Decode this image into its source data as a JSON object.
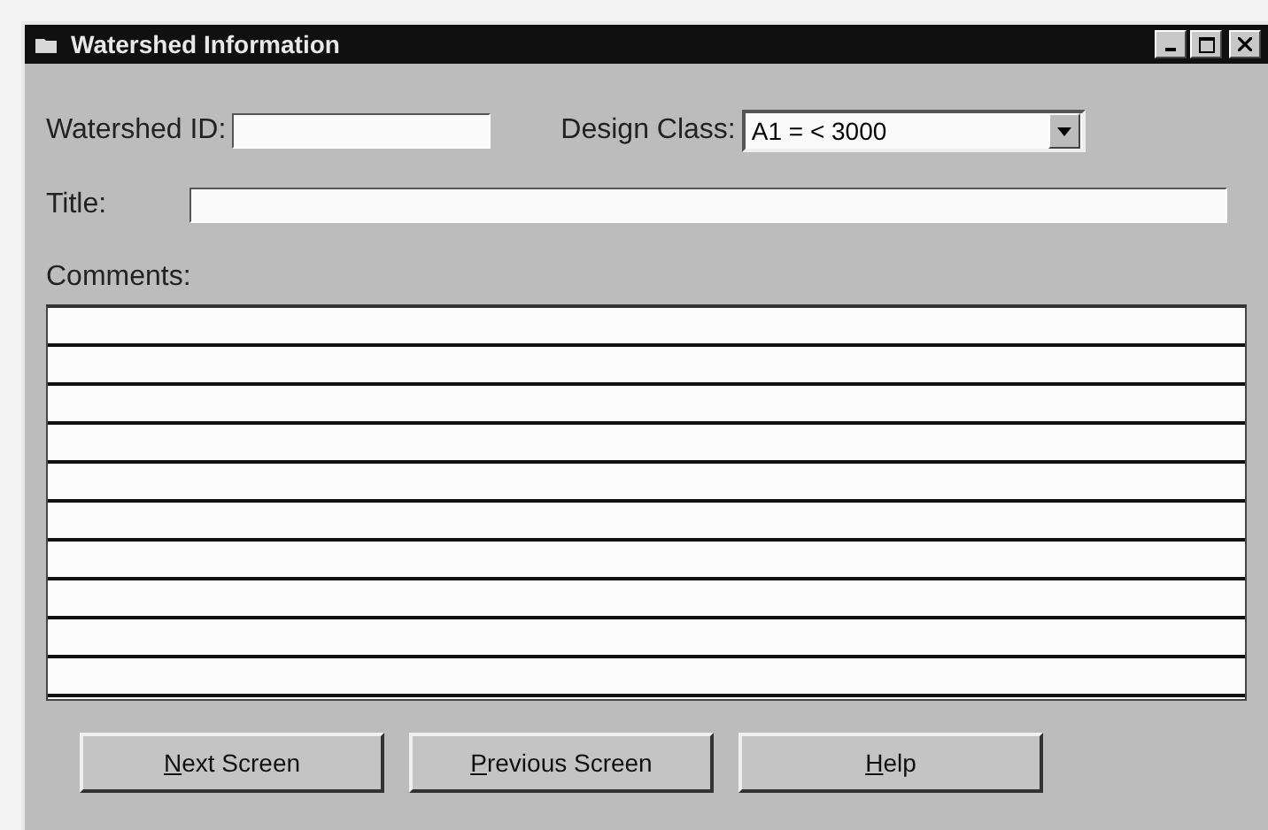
{
  "window": {
    "title": "Watershed Information"
  },
  "watershed_id": {
    "label": "Watershed ID:"
  },
  "design_class": {
    "label": "Design Class:",
    "value": "A1 = < 3000"
  },
  "title_field": {
    "label": "Title:"
  },
  "comments": {
    "label": "Comments:"
  },
  "buttons": [
    {
      "label": "Next Screen"
    },
    {
      "label": "Previous Screen"
    },
    {
      "label": "Help"
    }
  ]
}
